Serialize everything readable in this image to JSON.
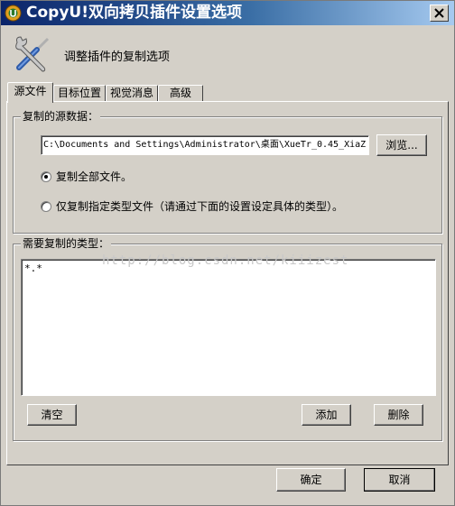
{
  "window": {
    "title": "CopyU!双向拷贝插件设置选项"
  },
  "header": {
    "text": "调整插件的复制选项"
  },
  "tabs": [
    {
      "label": "源文件",
      "active": true
    },
    {
      "label": "目标位置",
      "active": false
    },
    {
      "label": "视觉消息",
      "active": false
    },
    {
      "label": "高级",
      "active": false
    }
  ],
  "source": {
    "legend": "复制的源数据：",
    "path_value": "C:\\Documents and Settings\\Administrator\\桌面\\XueTr_0.45_XiaZ",
    "browse_label": "浏览...",
    "option_all_label": "复制全部文件。",
    "option_all_selected": true,
    "option_types_label": "仅复制指定类型文件（请通过下面的设置设定具体的类型）。",
    "option_types_selected": false
  },
  "types": {
    "legend": "需要复制的类型：",
    "content": "*.*",
    "clear_label": "清空",
    "add_label": "添加",
    "delete_label": "删除"
  },
  "watermark": "http://blog.csdn.net/kiiizest",
  "footer": {
    "ok_label": "确定",
    "cancel_label": "取消"
  },
  "colors": {
    "title_start": "#0a246a",
    "title_end": "#a6caf0",
    "face": "#d4d0c8"
  }
}
